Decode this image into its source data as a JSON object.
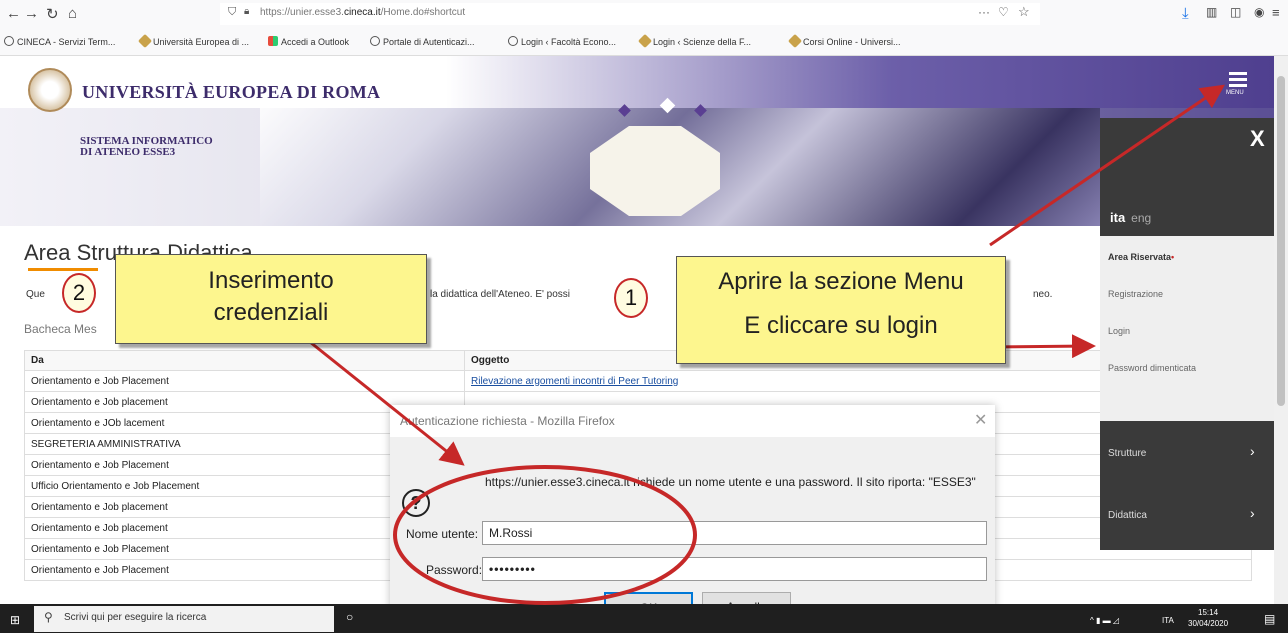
{
  "browser": {
    "url_prefix": "https://unier.esse3.",
    "url_domain": "cineca.it",
    "url_path": "/Home.do#shortcut",
    "bookmarks": [
      "CINECA - Servizi Term...",
      "Università Europea di ...",
      "Accedi a Outlook",
      "Portale di Autenticazi...",
      "Login ‹ Facoltà Econo...",
      "Login ‹ Scienze della F...",
      "Corsi Online - Universi..."
    ]
  },
  "header": {
    "university": "UNIVERSITÀ EUROPEA DI ROMA",
    "system_line1": "SISTEMA INFORMATICO",
    "system_line2": "DI ATENEO ESSE3",
    "menu_label": "MENU"
  },
  "main": {
    "title": "Area Struttura Didattica",
    "intro_start": "Que",
    "intro_mid": "la didattica dell'Ateneo. E' possi",
    "intro_end": "neo.",
    "board_title": "Bacheca Mes",
    "table": {
      "headers": [
        "Da",
        "Oggetto"
      ],
      "rows": [
        [
          "Orientamento e Job Placement",
          "Rilevazione argomenti incontri di Peer Tutoring"
        ],
        [
          "Orientamento e Job placement",
          ""
        ],
        [
          "Orientamento e JOb lacement",
          ""
        ],
        [
          "SEGRETERIA AMMINISTRATIVA",
          ""
        ],
        [
          "Orientamento e Job Placement",
          ""
        ],
        [
          "Ufficio Orientamento e Job Placement",
          ""
        ],
        [
          "Orientamento e Job placement",
          ""
        ],
        [
          "Orientamento e Job placement",
          ""
        ],
        [
          "Orientamento e Job Placement",
          ""
        ],
        [
          "Orientamento e Job Placement",
          ""
        ]
      ]
    }
  },
  "side_menu": {
    "close": "X",
    "lang_ita": "ita",
    "lang_eng": "eng",
    "area_riservata": "Area Riservata",
    "registrazione": "Registrazione",
    "login": "Login",
    "password_dimenticata": "Password dimenticata",
    "strutture": "Strutture",
    "didattica": "Didattica"
  },
  "dialog": {
    "title": "Autenticazione richiesta - Mozilla Firefox",
    "message": "https://unier.esse3.cineca.it richiede un nome utente e una password. Il sito riporta: \"ESSE3\"",
    "username_label": "Nome utente:",
    "username_value": "M.Rossi",
    "password_label": "Password:",
    "password_value": "•••••••••",
    "ok": "OK",
    "cancel": "Annulla"
  },
  "annotations": {
    "callout_1_line1": "Aprire la sezione Menu",
    "callout_1_line2": "E cliccare su login",
    "callout_2_line1": "Inserimento",
    "callout_2_line2": "credenziali",
    "step_1": "1",
    "step_2": "2",
    "arrow_color": "#c62828"
  },
  "taskbar": {
    "search_placeholder": "Scrivi qui per eseguire la ricerca",
    "lang": "ITA",
    "time": "15:14",
    "date": "30/04/2020"
  }
}
